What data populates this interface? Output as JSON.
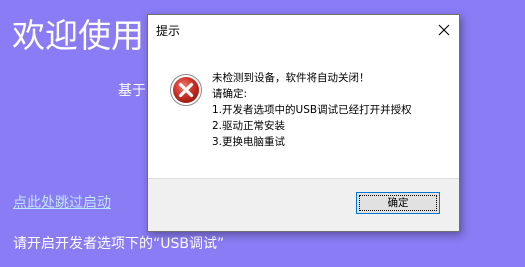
{
  "background": {
    "title": "欢迎使用",
    "subtitle": "基于",
    "skip_link": "点此处跳过启动",
    "hint": "请开启开发者选项下的“USB调试”"
  },
  "dialog": {
    "title": "提示",
    "icon": "error-icon",
    "message_lines": [
      "未检测到设备，软件将自动关闭！",
      "请确定:",
      "1.开发者选项中的USB调试已经打开并授权",
      "2.驱动正常安装",
      "3.更换电脑重试"
    ],
    "ok_label": "确定"
  },
  "colors": {
    "background": "#8a7cf4",
    "link": "#bfe6ff",
    "error_red": "#c42b1c"
  }
}
